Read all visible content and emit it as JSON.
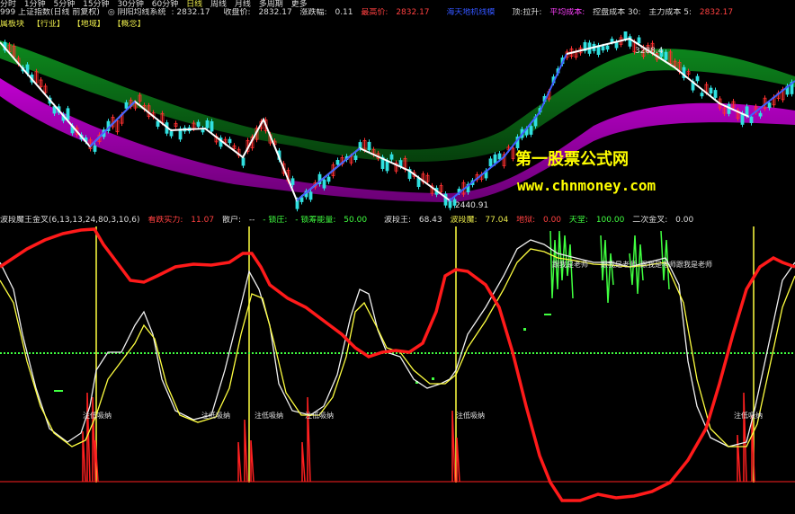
{
  "period_bar": {
    "items": [
      "分时",
      "1分钟",
      "5分钟",
      "15分钟",
      "30分钟",
      "60分钟",
      "日线",
      "周线",
      "月线",
      "多周期",
      "更多"
    ]
  },
  "status_bar": {
    "security": "999 上证指数(日线 前复权)",
    "ind_name": "◎ 阴阳均线系统",
    "ind_value": ": 2832.17",
    "close_label": "收盘价:",
    "close_value": "2832.17",
    "change_label": "涨跌幅:",
    "change_value": "0.11",
    "high_label": "最高价:",
    "high_value": "2832.17",
    "mid_tag": "海天地机线模",
    "signal_label": "顶:拉升:",
    "cost_label": "平均成本:",
    "hold_label": "控盘成本 30:",
    "main_label": "主力成本 5:",
    "end_value": "2832.17"
  },
  "sector_bar": {
    "items": [
      "属板块",
      "【行业】",
      "【地域】",
      "【概念】"
    ]
  },
  "price_chart": {
    "peak_label": "3288.4",
    "low_label": "2440.91",
    "colors": {
      "white_zig": "#ffffff",
      "blue_zig": "#4060ff",
      "green_band": "#0a7a1a",
      "purple_band": "#b000c0"
    }
  },
  "watermark": {
    "line1": "第一股票公式网",
    "line2": "www.chnmoney.com"
  },
  "indicator_bar": {
    "title": "波段魔王金叉(6,13,13,24,80,3,10,6)",
    "buy_label": "看跌实力:",
    "buy_value": "11.07",
    "retail_label": "散户:",
    "retail_value": "--",
    "zhuang_label": "- 锁庄:",
    "zhuang_value": "- 锁筹能量:",
    "energy_value": "50.00",
    "wave_king_label": "波段王:",
    "wave_king_value": "68.43",
    "wave_demon_label": "波段魔:",
    "wave_demon_value": "77.04",
    "ground_label": "地狱:",
    "ground_value": "0.00",
    "sky_label": "天堂:",
    "sky_value": "100.00",
    "cross_label": "二次金叉:",
    "cross_value": "0.00"
  },
  "indicator_labels": {
    "absorb": "注低吸纳",
    "teacher": "跟我是老师"
  }
}
